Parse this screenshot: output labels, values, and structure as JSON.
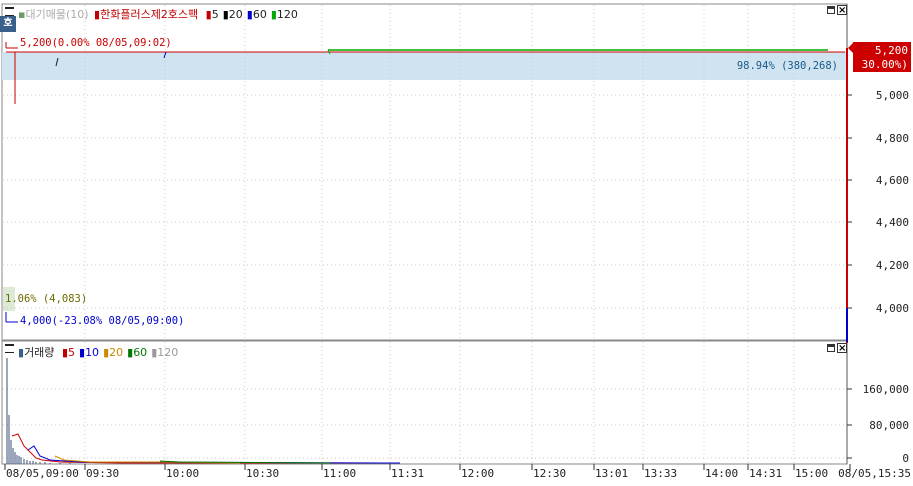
{
  "price_panel": {
    "corner_label": "호",
    "legend": {
      "pending": "대기매물(10)",
      "stock": "한화플러스제2호스팩",
      "ma": [
        {
          "label": "5",
          "color": "#c00000"
        },
        {
          "label": "20",
          "color": "#000000"
        },
        {
          "label": "60",
          "color": "#0000cc"
        },
        {
          "label": "120",
          "color": "#00aa00"
        }
      ]
    },
    "high_marker": "5,200(0.00% 08/05,09:02)",
    "low_marker": "4,000(-23.08% 08/05,09:00)",
    "pending_high": "98.94% (380,268)",
    "pending_low": "1.06% (4,083)",
    "current_price": "5,200",
    "current_change": "( 30.00%)",
    "y_ticks": [
      "5,000",
      "4,800",
      "4,600",
      "4,400",
      "4,200",
      "4,000"
    ]
  },
  "volume_panel": {
    "legend": {
      "title": "거래량",
      "ma": [
        {
          "label": "5",
          "color": "#c00000"
        },
        {
          "label": "10",
          "color": "#0000cc"
        },
        {
          "label": "20",
          "color": "#cc8800"
        },
        {
          "label": "60",
          "color": "#007700"
        },
        {
          "label": "120",
          "color": "#999999"
        }
      ]
    },
    "y_ticks": [
      "160,000",
      "80,000",
      "0"
    ]
  },
  "x_axis": [
    "08/05,09:00",
    "09:30",
    "10:00",
    "10:30",
    "11:00",
    "11:31",
    "12:00",
    "12:30",
    "13:01",
    "13:33",
    "14:00",
    "14:31",
    "15:00",
    "08/05,15:35"
  ],
  "chart_data": {
    "type": "line",
    "title": "한화플러스제2호스팩",
    "y_range": [
      3880,
      5250
    ],
    "high": 5200,
    "low": 4000,
    "last": 5200,
    "change_pct": 30.0,
    "volume_range": [
      0,
      240000
    ],
    "pending_orders": [
      {
        "range": "high",
        "pct": 98.94,
        "qty": 380268
      },
      {
        "range": "low",
        "pct": 1.06,
        "qty": 4083
      }
    ]
  },
  "colors": {
    "up": "#cc0000",
    "down": "#0000cc",
    "ma120": "#00aa00",
    "pending_band": "#cfe4f0",
    "grid": "#c8c8c8"
  }
}
